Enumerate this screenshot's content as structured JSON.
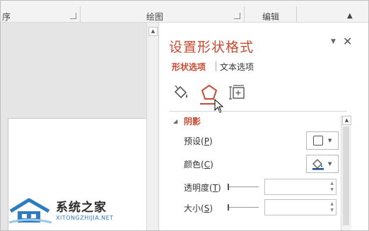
{
  "ribbon": {
    "group_left": "序",
    "group_drawing": "绘图",
    "group_editing": "编辑"
  },
  "pane": {
    "title": "设置形状格式",
    "menu_glyph": "▼",
    "close_glyph": "✕",
    "tabs": {
      "shape_options": "形状选项",
      "text_options": "文本选项"
    },
    "icons": [
      "fill-line-icon",
      "effects-icon",
      "size-properties-icon"
    ],
    "section": {
      "title": "阴影",
      "rows": [
        {
          "label": "预设",
          "key": "P"
        },
        {
          "label": "颜色",
          "key": "C"
        },
        {
          "label": "透明度",
          "key": "T"
        },
        {
          "label": "大小",
          "key": "S"
        }
      ]
    }
  },
  "watermark": {
    "title": "系统之家",
    "subtitle": "XITONGZHIJIA.NET"
  },
  "colors": {
    "accent": "#c94a31",
    "watermark_blue": "#2f7bc1"
  }
}
